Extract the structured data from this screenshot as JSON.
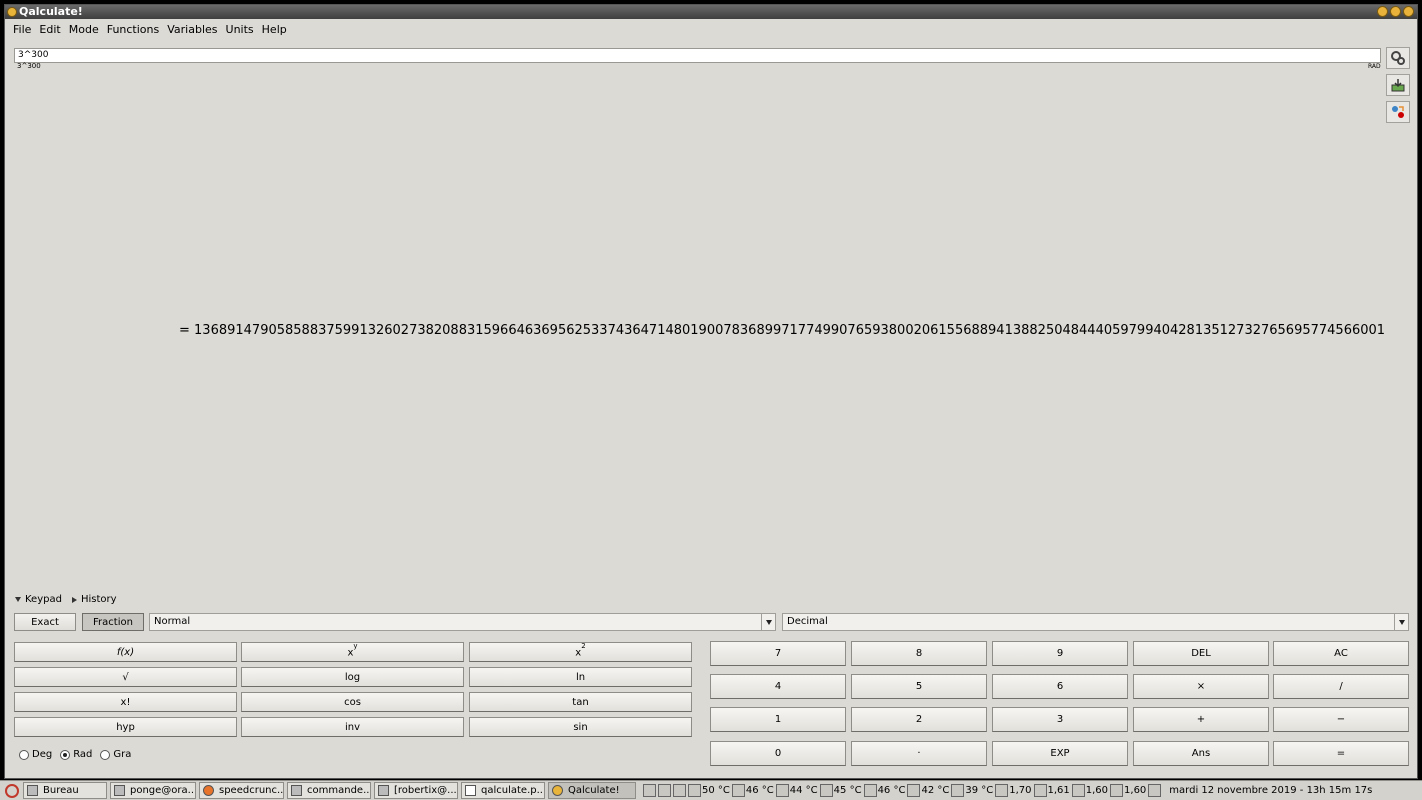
{
  "window": {
    "title": "Qalculate!"
  },
  "menu": [
    "File",
    "Edit",
    "Mode",
    "Functions",
    "Variables",
    "Units",
    "Help"
  ],
  "expression": {
    "value": "3^300",
    "parsed": "3^300",
    "angle_mode_indicator": "RAD"
  },
  "result": "= 136891479058588375991326027382088315966463695625337436471480190078368997177499076593800206155688941388250484440597994042813512732765695774566001",
  "side_toolbar": [
    "preferences-icon",
    "store-icon",
    "convert-icon"
  ],
  "expanders": {
    "keypad": "Keypad",
    "history": "History"
  },
  "mode_row": {
    "exact": "Exact",
    "fraction": "Fraction",
    "display_mode": "Normal",
    "base": "Decimal"
  },
  "function_keys": [
    [
      "f(x)",
      "x^y",
      "x^2"
    ],
    [
      "√",
      "log",
      "ln"
    ],
    [
      "x!",
      "cos",
      "tan"
    ],
    [
      "hyp",
      "inv",
      "sin"
    ]
  ],
  "number_keys": [
    [
      "7",
      "8",
      "9",
      "DEL",
      "AC"
    ],
    [
      "4",
      "5",
      "6",
      "×",
      "/"
    ],
    [
      "1",
      "2",
      "3",
      "+",
      "−"
    ],
    [
      "0",
      "·",
      "EXP",
      "Ans",
      "="
    ]
  ],
  "angle_units": {
    "deg": "Deg",
    "rad": "Rad",
    "gra": "Gra",
    "selected": "Rad"
  },
  "taskbar": {
    "tasks": [
      "Bureau",
      "ponge@ora...",
      "speedcrunc...",
      "commande...",
      "[robertix@...",
      "qalculate.p...",
      "Qalculate!"
    ],
    "active": "Qalculate!",
    "sensors": [
      "50 °C",
      "46 °C",
      "44 °C",
      "45 °C",
      "46 °C",
      "42 °C",
      "39 °C",
      "1,70",
      "1,61",
      "1,60",
      "1,60"
    ],
    "clock": "mardi 12 novembre 2019 - 13h 15m 17s"
  }
}
